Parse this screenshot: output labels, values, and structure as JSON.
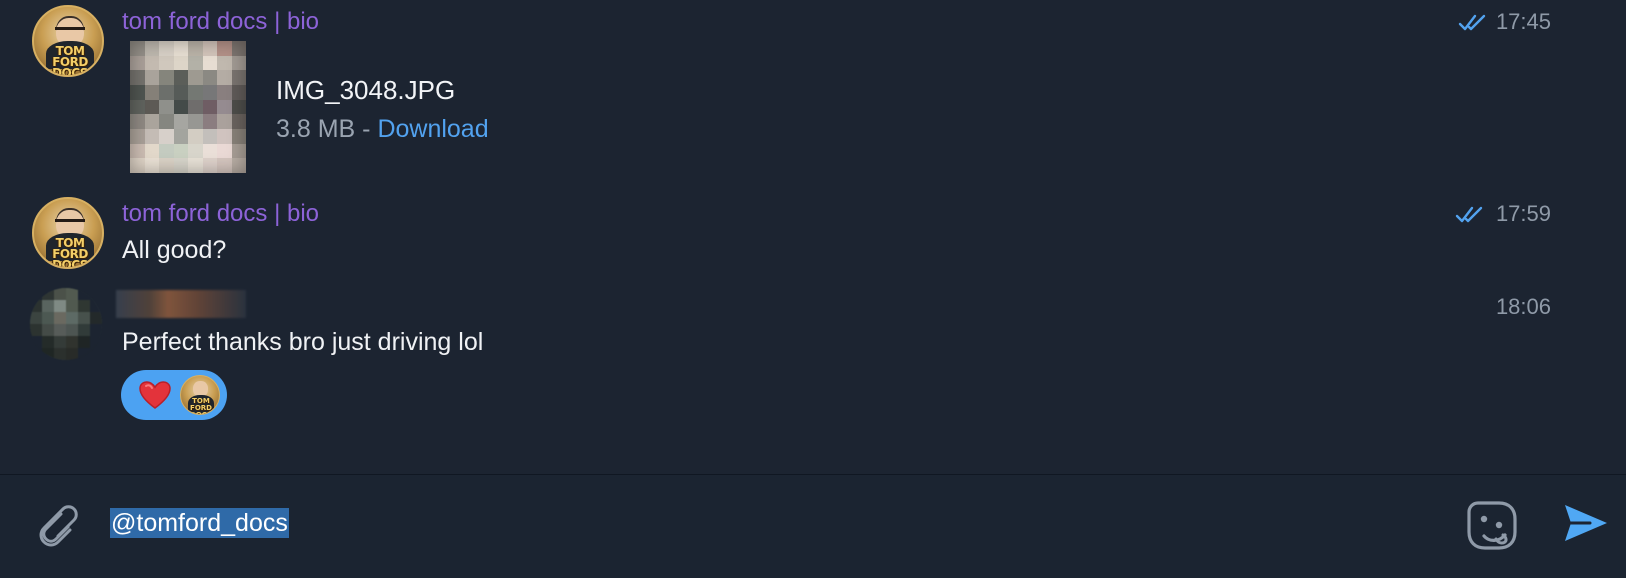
{
  "colors": {
    "background": "#1c2431",
    "sender": "#8d63d8",
    "accent": "#52a2ef",
    "reaction": "#4ca2f2",
    "text": "#f0f2f5",
    "muted": "#8f9aa8"
  },
  "messages": [
    {
      "sender": "tom ford docs | bio",
      "time": "17:45",
      "status_icon": "double-check-icon",
      "file": {
        "name": "IMG_3048.JPG",
        "size": "3.8 MB",
        "separator": "-",
        "action": "Download"
      }
    },
    {
      "sender": "tom ford docs | bio",
      "time": "17:59",
      "status_icon": "double-check-icon",
      "text": "All good?"
    },
    {
      "sender": "",
      "time": "18:06",
      "text": "Perfect thanks bro just driving lol",
      "reaction": {
        "emoji": "❤️",
        "icon": "heart-icon"
      }
    }
  ],
  "avatars": {
    "tom_ford_logo": "TOM FORD DOCS",
    "reaction_logo": "TOM FORD DOCS"
  },
  "composer": {
    "value": "@tomford_docs",
    "attach_icon": "paperclip-icon",
    "sticker_icon": "sticker-icon",
    "send_icon": "send-icon"
  }
}
